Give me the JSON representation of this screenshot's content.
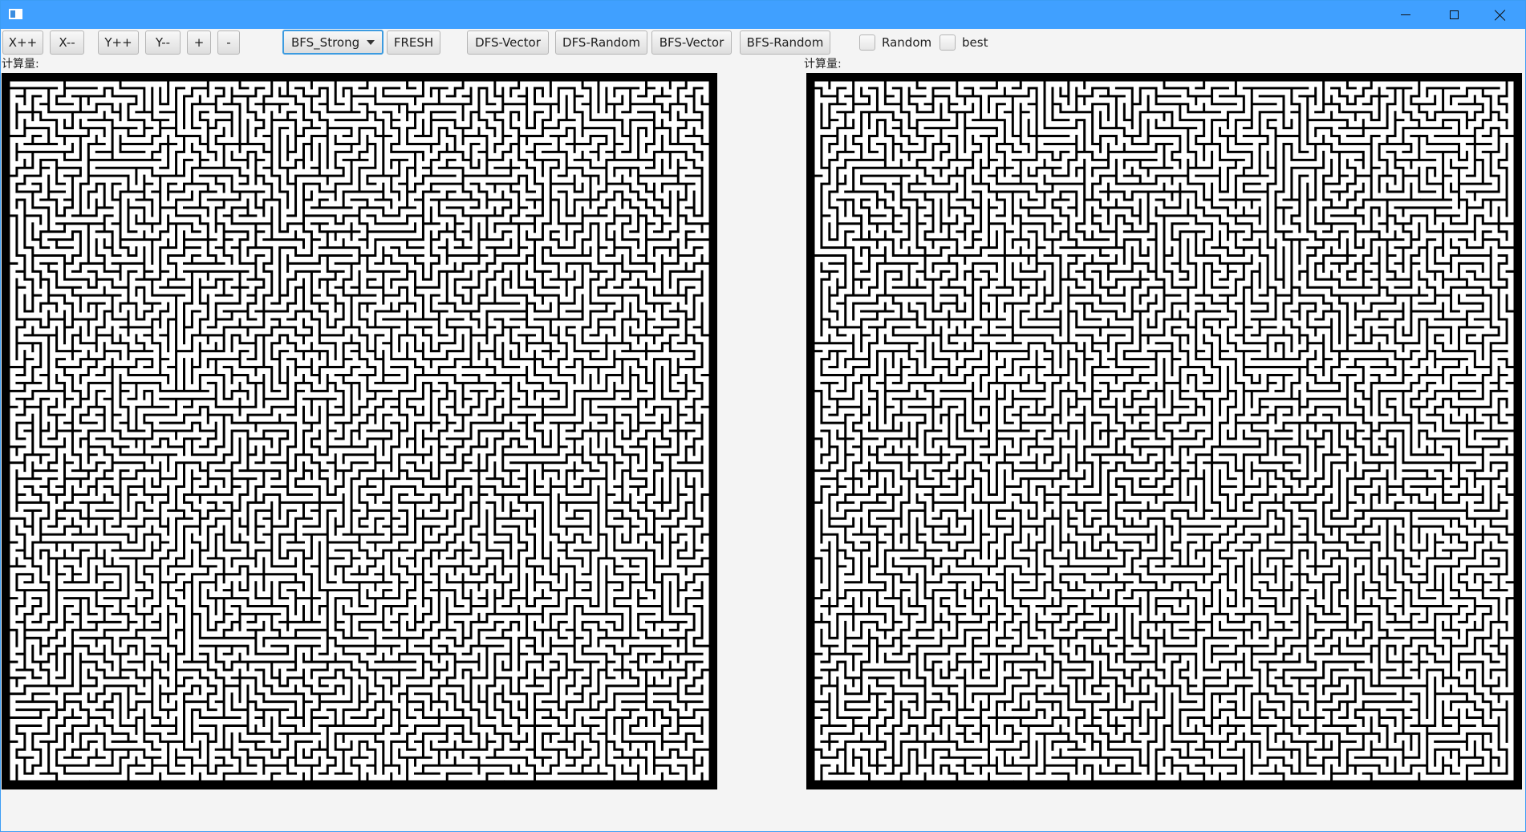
{
  "window": {
    "title": ""
  },
  "toolbar": {
    "x_inc": "X++",
    "x_dec": "X--",
    "y_inc": "Y++",
    "y_dec": "Y--",
    "zoom_in": "+",
    "zoom_out": "-",
    "algorithm_selected": "BFS_Strong",
    "fresh": "FRESH",
    "dfs_vector": "DFS-Vector",
    "dfs_random": "DFS-Random",
    "bfs_vector": "BFS-Vector",
    "bfs_random": "BFS-Random",
    "random_label": "Random",
    "best_label": "best",
    "random_checked": false,
    "best_checked": false
  },
  "panels": {
    "left": {
      "label": "计算量:"
    },
    "right": {
      "label": "计算量:"
    }
  },
  "colors": {
    "titlebar": "#40a0ff",
    "wall": "#000000",
    "path": "#ffffff",
    "combo_focus": "#3c9be0"
  },
  "icons": {
    "app": "app-window-icon",
    "minimize": "minimize-icon",
    "maximize": "maximize-icon",
    "close": "close-icon",
    "combo": "chevron-down-icon"
  }
}
